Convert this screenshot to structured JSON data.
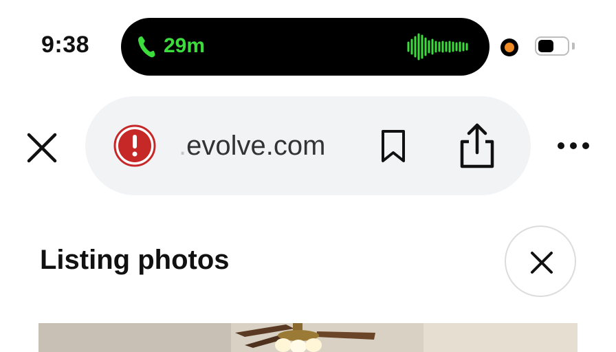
{
  "status_bar": {
    "time": "9:38",
    "call_duration": "29m",
    "call_icon": "phone-icon",
    "accent": "#3ddc3d",
    "mic_indicator_color": "#f08a24"
  },
  "browser": {
    "close_icon": "close-icon",
    "warning_icon": "warning-icon",
    "url_prefix": ".",
    "url": "evolve.com",
    "bookmark_icon": "bookmark-icon",
    "share_icon": "share-icon",
    "more_icon": "more-icon"
  },
  "page": {
    "title": "Listing photos",
    "close_icon": "close-icon"
  }
}
